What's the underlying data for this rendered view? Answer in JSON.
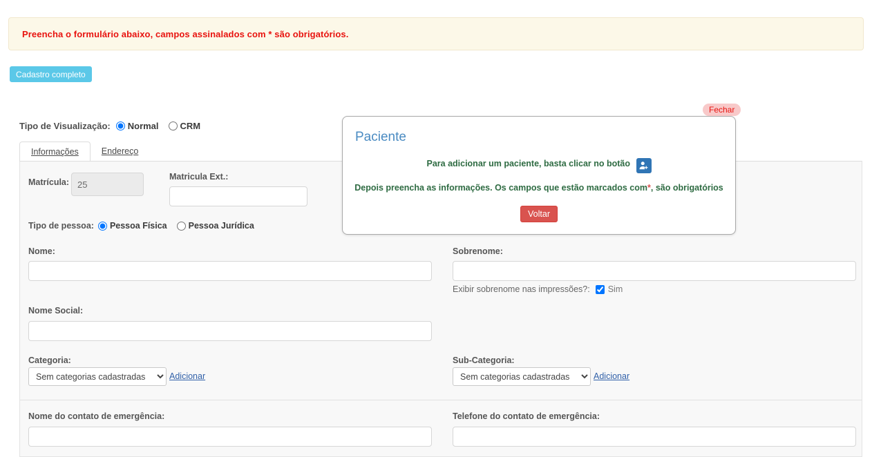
{
  "alert": {
    "message": "Preencha o formulário abaixo, campos assinalados com * são obrigatórios."
  },
  "toolbar": {
    "cadastro_completo_label": "Cadastro completo"
  },
  "visualization": {
    "label": "Tipo de Visualização:",
    "options": [
      {
        "label": "Normal",
        "selected": true
      },
      {
        "label": "CRM",
        "selected": false
      }
    ]
  },
  "tabs": [
    {
      "label": "Informações",
      "active": true
    },
    {
      "label": "Endereço",
      "active": false
    }
  ],
  "form": {
    "matricula": {
      "label": "Matrícula:",
      "value": "25",
      "disabled": true
    },
    "matricula_ext": {
      "label": "Matricula Ext.:",
      "value": "",
      "placeholder": ""
    },
    "tipo_pessoa": {
      "label": "Tipo de pessoa:",
      "options": [
        {
          "label": "Pessoa Física",
          "selected": true
        },
        {
          "label": "Pessoa Jurídica",
          "selected": false
        }
      ]
    },
    "nome": {
      "label": "Nome:",
      "value": "",
      "placeholder": ""
    },
    "sobrenome": {
      "label": "Sobrenome:",
      "value": "",
      "placeholder": ""
    },
    "exibir_sobrenome": {
      "label": "Exibir sobrenome nas impressões?:",
      "option_label": "Sim",
      "checked": true
    },
    "nome_social": {
      "label": "Nome Social:",
      "value": "",
      "placeholder": ""
    },
    "categoria": {
      "label": "Categoria:",
      "selected": "Sem categorias cadastradas",
      "options": [
        "Sem categorias cadastradas"
      ],
      "add_link": "Adicionar"
    },
    "sub_categoria": {
      "label": "Sub-Categoria:",
      "selected": "Sem categorias cadastradas",
      "options": [
        "Sem categorias cadastradas"
      ],
      "add_link": "Adicionar"
    },
    "contato_emergencia_nome": {
      "label": "Nome do contato de emergência:",
      "value": "",
      "placeholder": ""
    },
    "contato_emergencia_telefone": {
      "label": "Telefone do contato de emergência:",
      "value": "",
      "placeholder": ""
    }
  },
  "modal": {
    "title": "Paciente",
    "line1_prefix": "Para adicionar um paciente, basta clicar no botão",
    "add_patient_icon": "add-person-icon",
    "line2_before_star": "Depois preencha as informações. Os campos que estão marcados com",
    "line2_star": "*",
    "line2_after_star": ", são obrigatórios",
    "back_button": "Voltar",
    "close_button": "Fechar"
  },
  "colors": {
    "alert_bg": "#fcf8e8",
    "alert_text": "#e8130f",
    "info_button": "#5bc8e8",
    "modal_title": "#4a8bc2",
    "modal_text": "#2e6b42",
    "danger_button": "#d9534f",
    "close_badge_bg": "#f8c9c9",
    "link": "#2f5fa8",
    "panel_bg": "#f8f8f8"
  }
}
